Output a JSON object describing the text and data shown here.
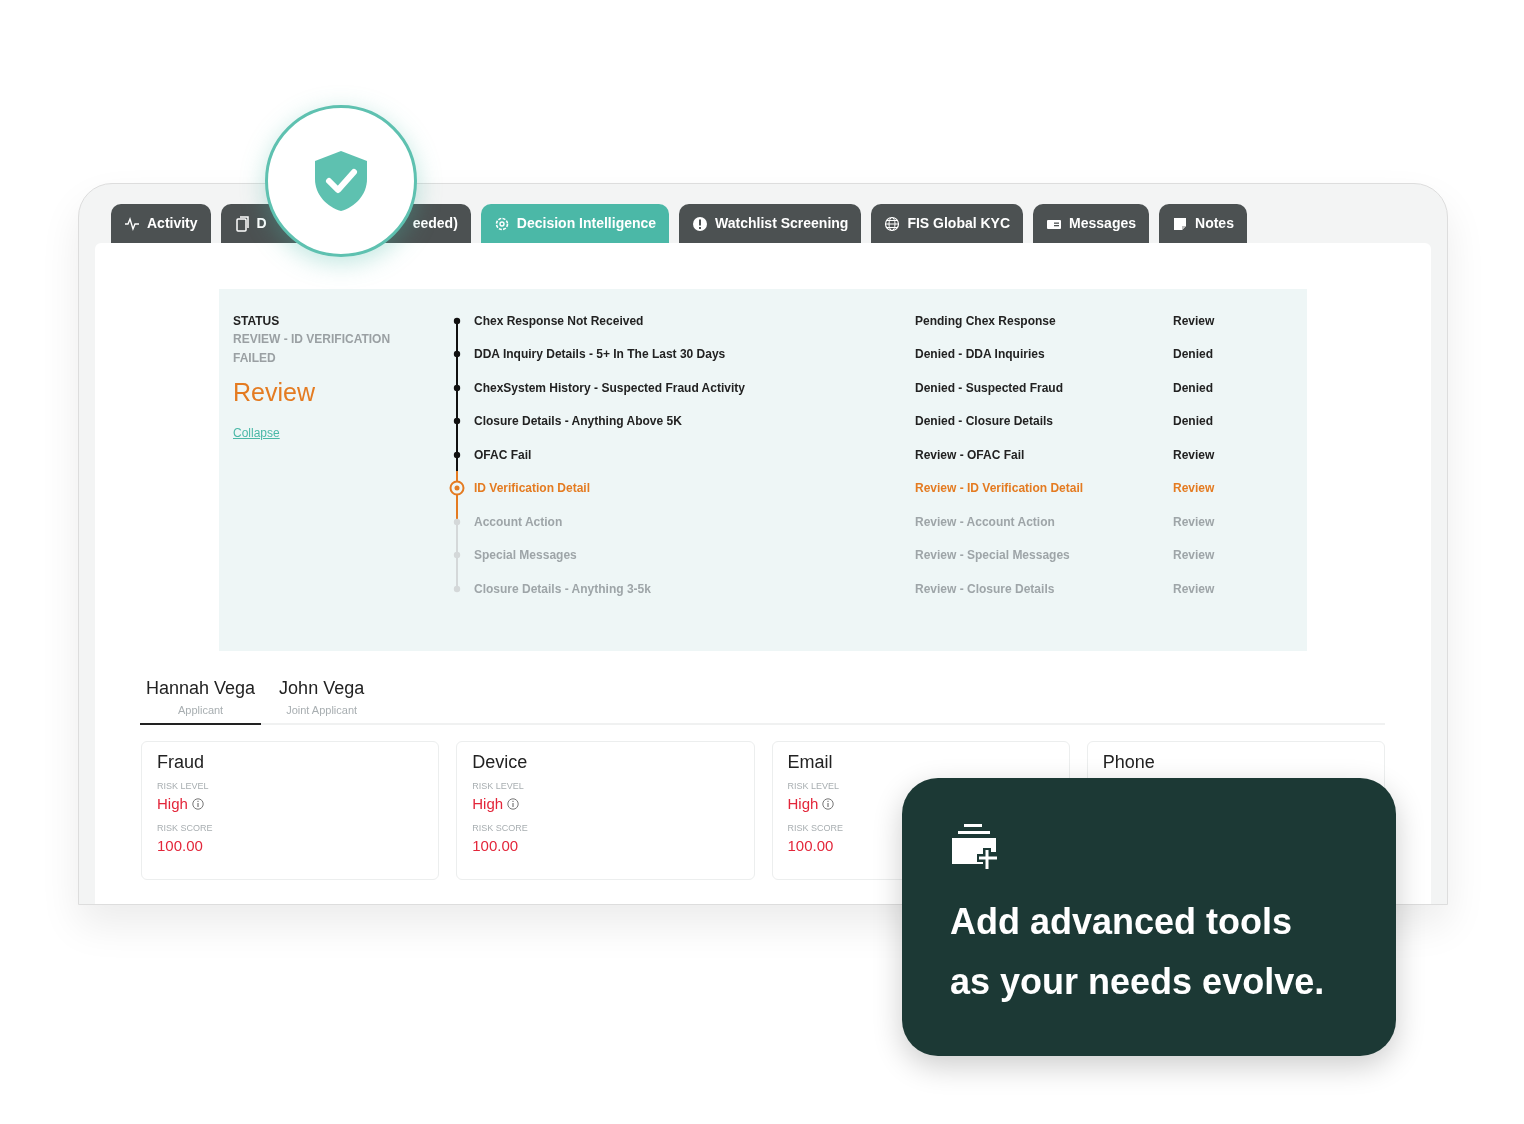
{
  "tabs": [
    {
      "label_parts": [
        "Activity"
      ],
      "selected": false
    },
    {
      "label_parts": [
        "D",
        "eeded)"
      ],
      "selected": false
    },
    {
      "label_parts": [
        "Decision Intelligence"
      ],
      "selected": true
    },
    {
      "label_parts": [
        "Watchlist Screening"
      ],
      "selected": false
    },
    {
      "label_parts": [
        "FIS Global KYC"
      ],
      "selected": false
    },
    {
      "label_parts": [
        "Messages"
      ],
      "selected": false
    },
    {
      "label_parts": [
        "Notes"
      ],
      "selected": false
    }
  ],
  "status": {
    "heading": "STATUS",
    "detail": "REVIEW - ID VERIFICATION FAILED",
    "decision": "Review",
    "collapse_link": "Collapse"
  },
  "steps": [
    {
      "kind": "done",
      "name": "Chex Response Not Received",
      "result": "Pending Chex Response",
      "outcome": "Review"
    },
    {
      "kind": "done",
      "name": "DDA Inquiry Details - 5+ In The Last 30 Days",
      "result": "Denied - DDA Inquiries",
      "outcome": "Denied"
    },
    {
      "kind": "done",
      "name": "ChexSystem History - Suspected Fraud Activity",
      "result": "Denied - Suspected Fraud",
      "outcome": "Denied"
    },
    {
      "kind": "done",
      "name": "Closure Details - Anything Above 5K",
      "result": "Denied - Closure Details",
      "outcome": "Denied"
    },
    {
      "kind": "done",
      "name": "OFAC Fail",
      "result": "Review - OFAC Fail",
      "outcome": "Review"
    },
    {
      "kind": "current",
      "name": "ID Verification Detail",
      "result": "Review - ID Verification Detail",
      "outcome": "Review"
    },
    {
      "kind": "pending",
      "name": "Account Action",
      "result": "Review - Account Action",
      "outcome": "Review"
    },
    {
      "kind": "pending",
      "name": "Special Messages",
      "result": "Review - Special Messages",
      "outcome": "Review"
    },
    {
      "kind": "pending",
      "name": "Closure Details - Anything 3-5k",
      "result": "Review - Closure Details",
      "outcome": "Review"
    }
  ],
  "applicants": [
    {
      "name": "Hannah Vega",
      "role": "Applicant",
      "selected": true
    },
    {
      "name": "John Vega",
      "role": "Joint Applicant",
      "selected": false
    }
  ],
  "risk_cards": [
    {
      "title": "Fraud",
      "level_label": "RISK LEVEL",
      "level": "High",
      "score_label": "RISK SCORE",
      "score": "100.00"
    },
    {
      "title": "Device",
      "level_label": "RISK LEVEL",
      "level": "High",
      "score_label": "RISK SCORE",
      "score": "100.00"
    },
    {
      "title": "Email",
      "level_label": "RISK LEVEL",
      "level": "High",
      "score_label": "RISK SCORE",
      "score": "100.00"
    },
    {
      "title": "Phone"
    }
  ],
  "callout": {
    "lines": [
      "Add advanced tools",
      "as your needs evolve."
    ]
  }
}
